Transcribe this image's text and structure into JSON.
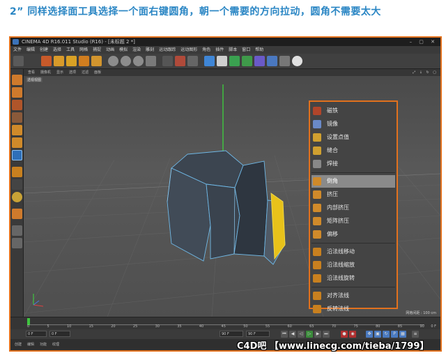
{
  "tutorial": {
    "heading": "2”  同样选择面工具选择一个面右键圆角，朝一个需要的方向拉动，圆角不需要太大",
    "watermark": "C4D吧 【www.linecg.com/tieba/1799】"
  },
  "window": {
    "title": "CINEMA 4D R16.011 Studio (R16) - [未标题 2 *]",
    "controls": "– ▢ ✕"
  },
  "menubar": [
    "文件",
    "编辑",
    "创建",
    "选择",
    "工具",
    "网格",
    "捕捉",
    "动画",
    "模拟",
    "渲染",
    "雕刻",
    "运动跟踪",
    "运动图形",
    "角色",
    "插件",
    "脚本",
    "窗口",
    "帮助"
  ],
  "viewport": {
    "menu": [
      "查看",
      "摄像机",
      "显示",
      "选项",
      "过滤",
      "面板"
    ],
    "label": "透视视图",
    "header_icons": "⤢ ↓ ↻ ▢",
    "grid_info": "网格间距 : 100 cm"
  },
  "context_menu": {
    "groups": [
      [
        {
          "label": "磁铁",
          "icon": "magnet-icon"
        },
        {
          "label": "镜像",
          "icon": "mirror-icon"
        },
        {
          "label": "设置点值",
          "icon": "set-point-value-icon"
        },
        {
          "label": "缝合",
          "icon": "stitch-icon"
        },
        {
          "label": "焊接",
          "icon": "weld-icon"
        }
      ],
      [
        {
          "label": "倒角",
          "icon": "bevel-icon",
          "active": true
        },
        {
          "label": "挤压",
          "icon": "extrude-icon"
        },
        {
          "label": "内部挤压",
          "icon": "extrude-inner-icon"
        },
        {
          "label": "矩阵挤压",
          "icon": "matrix-extrude-icon"
        },
        {
          "label": "偏移",
          "icon": "smooth-shift-icon"
        }
      ],
      [
        {
          "label": "沿法线移动",
          "icon": "normal-move-icon"
        },
        {
          "label": "沿法线缩放",
          "icon": "normal-scale-icon"
        },
        {
          "label": "沿法线旋转",
          "icon": "normal-rotate-icon"
        }
      ],
      [
        {
          "label": "对齐法线",
          "icon": "align-normals-icon"
        },
        {
          "label": "反转法线",
          "icon": "reverse-normals-icon"
        }
      ]
    ]
  },
  "timeline": {
    "ticks": [
      "0",
      "5",
      "10",
      "15",
      "20",
      "25",
      "30",
      "35",
      "40",
      "45",
      "50",
      "55",
      "60",
      "65",
      "70",
      "75",
      "80",
      "85",
      "90"
    ],
    "end_label": "0 F"
  },
  "transport": {
    "start": "0 F",
    "current": "0 F",
    "end": "90 F",
    "end2": "90 F"
  },
  "bottom_menu": [
    "创建",
    "编辑",
    "功能",
    "纹理"
  ],
  "colors": {
    "accent": "#e2711d",
    "heading": "#2a86c4",
    "selected_face": "#e8c21a",
    "object": "#3c4550",
    "edge": "#6fb8e6"
  }
}
